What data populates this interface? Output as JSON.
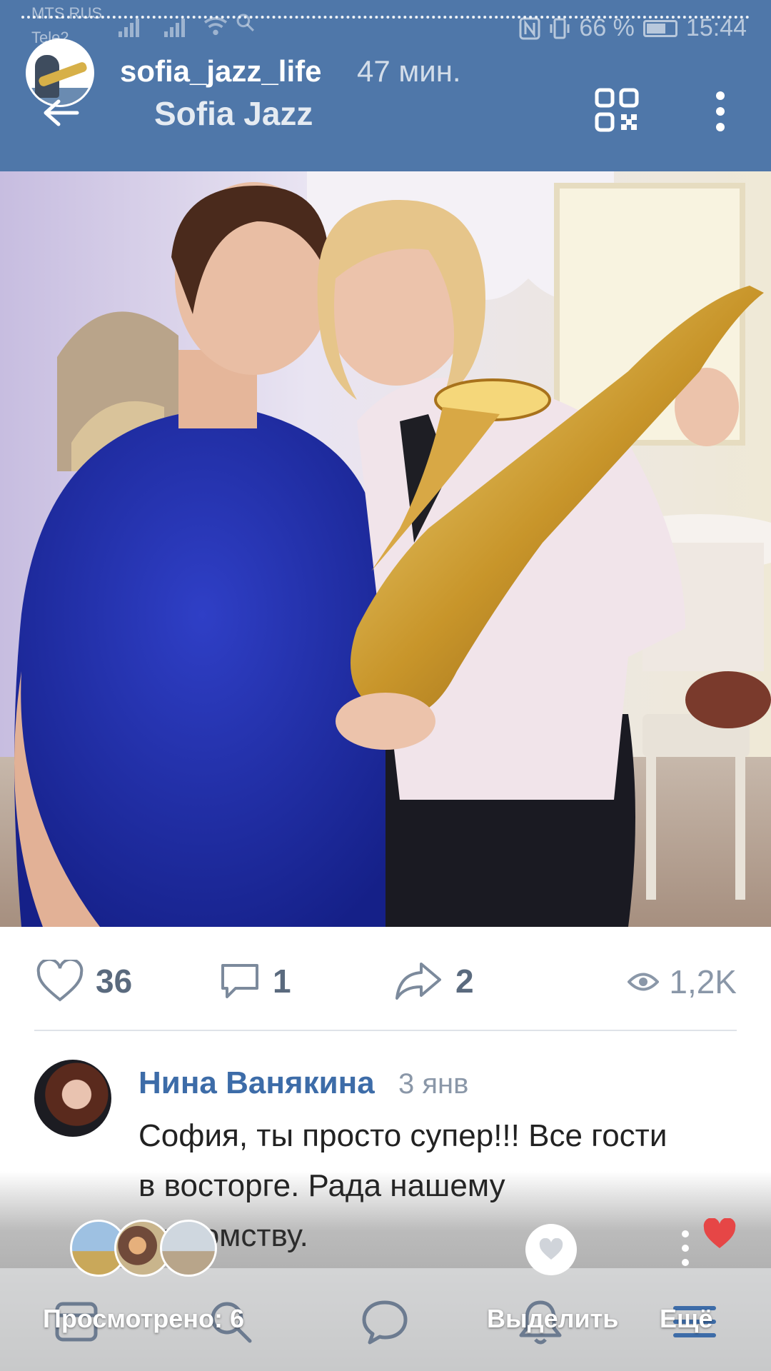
{
  "status_bar": {
    "carrier_1": "MTS RUS",
    "carrier_2": "Tele2",
    "battery": "66 %",
    "time": "15:44"
  },
  "story": {
    "username": "sofia_jazz_life",
    "time_ago": "47 мин."
  },
  "header": {
    "title": "Sofia Jazz",
    "icons": [
      "back-arrow-icon",
      "qr-code-icon",
      "more-vertical-icon"
    ]
  },
  "post": {
    "likes": "36",
    "comments": "1",
    "shares": "2",
    "views": "1,2K"
  },
  "comment": {
    "author": "Нина Ванякина",
    "date": "3 янв",
    "text": "София, ты просто супер!!! Все гости в восторге. Рада нашему знакомству."
  },
  "story_footer": {
    "viewed_label": "Просмотрено: 6",
    "highlight_label": "Выделить",
    "more_label": "Ещё"
  },
  "colors": {
    "header_bg": "#4f77a9",
    "link": "#3d6ca8",
    "like_red": "#e64646"
  }
}
